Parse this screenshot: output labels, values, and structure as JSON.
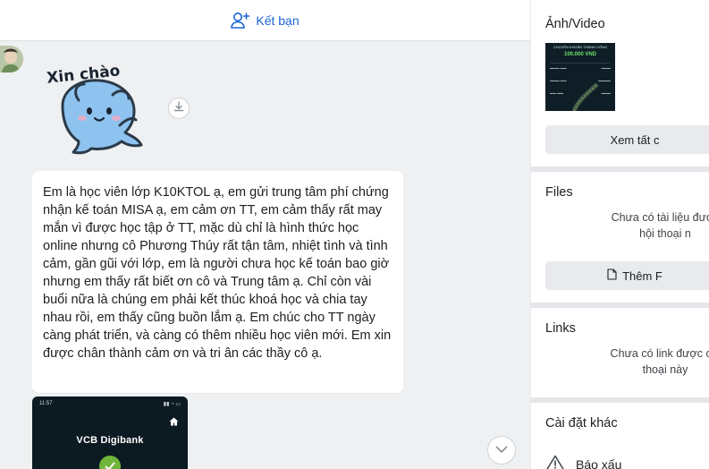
{
  "chat": {
    "add_friend_label": "Kết bạn",
    "sticker_caption": "Xin chào",
    "message_text": "Em là học viên lớp K10KTOL ạ, em gửi trung tâm phí chứng nhận kế toán MISA ạ, em cảm ơn TT, em cảm thấy rất may mắn vì được học tập ở TT, mặc dù chỉ là hình thức học online nhưng cô Phương Thúy rất tận tâm, nhiệt tình và tình cảm, gần gũi với lớp, em là người chưa học kế toán bao giờ nhưng em thấy rất biết ơn cô và Trung tâm ạ. Chỉ còn vài buổi nữa là chúng em phải kết thúc khoá học và chia tay nhau rồi, em thấy cũng buồn lắm ạ. Em chúc cho TT ngày càng phát triển, và càng có thêm nhiều học viên mới. Em xin được chân thành cảm ơn và tri ân các thầy cô ạ.",
    "image_time": "11:57",
    "image_brand": "VCB Digibank"
  },
  "panel": {
    "media": {
      "title": "Ảnh/Video",
      "thumb_header": "CHUYỂN KHOẢN THÀNH CÔNG",
      "thumb_amount": "100.000 VND",
      "view_all_label": "Xem tất c"
    },
    "files": {
      "title": "Files",
      "empty_line1": "Chưa có tài liệu được",
      "empty_line2": "hội thoại n",
      "add_label": "Thêm F"
    },
    "links": {
      "title": "Links",
      "empty_line1": "Chưa có link được chi",
      "empty_line2": "thoại này"
    },
    "settings": {
      "title": "Cài đặt khác",
      "report_label": "Báo xấu"
    }
  },
  "colors": {
    "accent": "#1a64d6",
    "chat_bg": "#eef0f1",
    "panel_bg": "#e4e6e9"
  }
}
